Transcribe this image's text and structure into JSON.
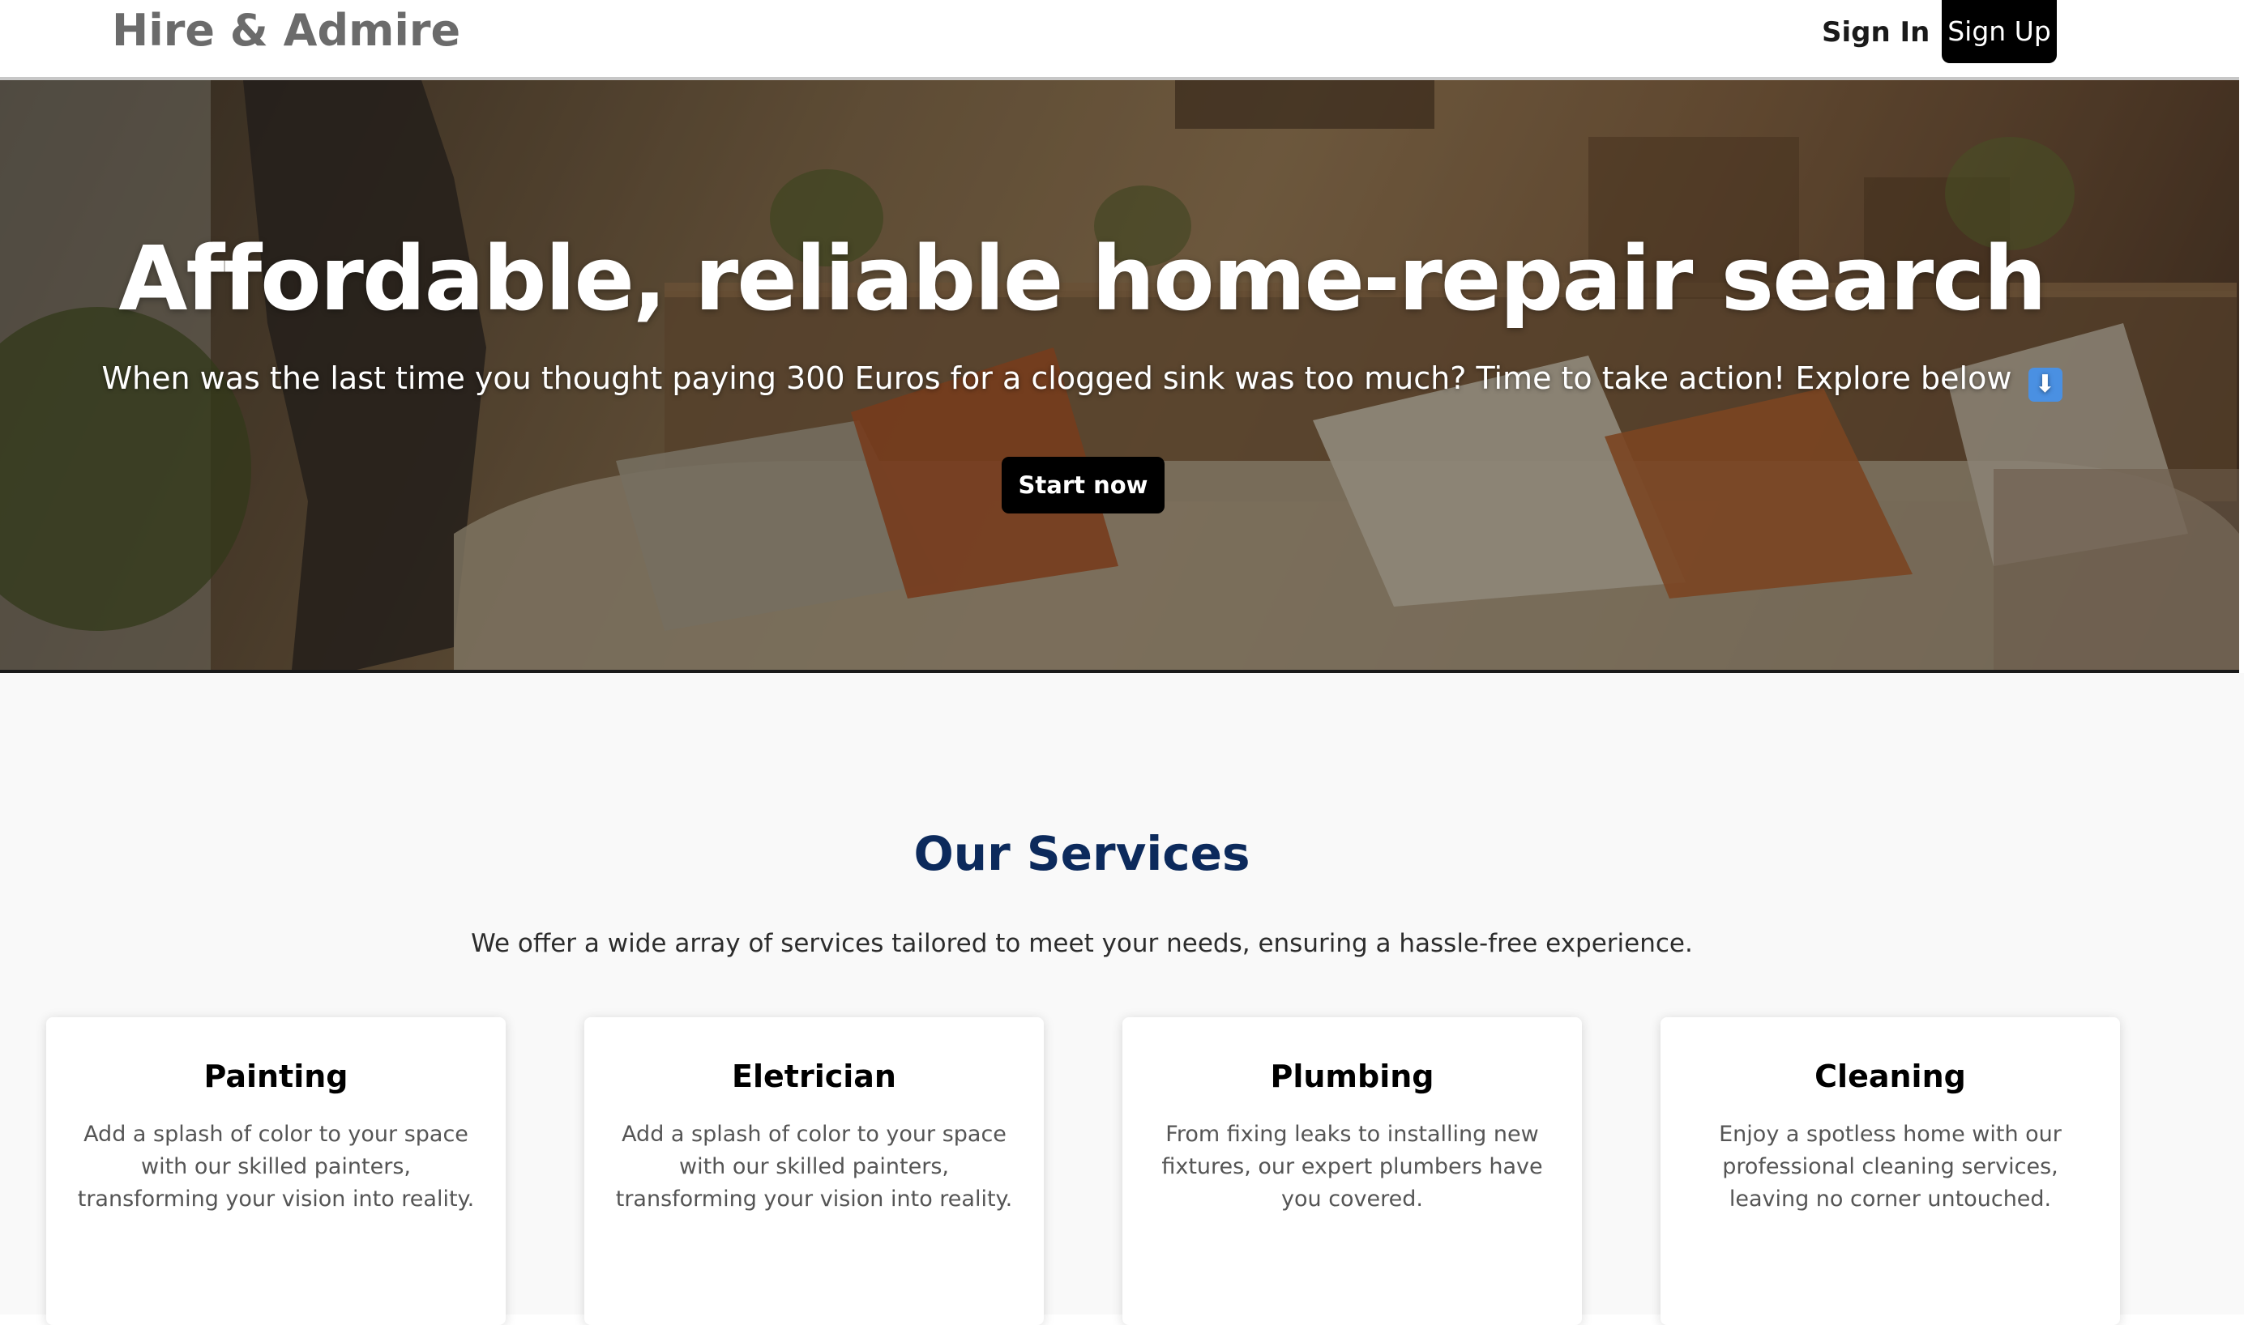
{
  "header": {
    "logo": "Hire & Admire",
    "sign_in": "Sign In",
    "sign_up": "Sign Up"
  },
  "hero": {
    "title": "Affordable, reliable home-repair search",
    "subtitle": "When was the last time you thought paying 300 Euros for a clogged sink was too much? Time to take action! Explore below",
    "arrow_icon": "⬇",
    "cta": "Start now"
  },
  "services": {
    "title": "Our Services",
    "subtitle": "We offer a wide array of services tailored to meet your needs, ensuring a hassle-free experience.",
    "items": [
      {
        "title": "Painting",
        "description": "Add a splash of color to your space with our skilled painters, transforming your vision into reality."
      },
      {
        "title": "Eletrician",
        "description": "Add a splash of color to your space with our skilled painters, transforming your vision into reality."
      },
      {
        "title": "Plumbing",
        "description": "From fixing leaks to installing new fixtures, our expert plumbers have you covered."
      },
      {
        "title": "Cleaning",
        "description": "Enjoy a spotless home with our professional cleaning services, leaving no corner untouched."
      }
    ]
  },
  "colors": {
    "brand_navy": "#0c2a5c",
    "button_black": "#000000",
    "logo_gray": "#6b6b6b"
  }
}
